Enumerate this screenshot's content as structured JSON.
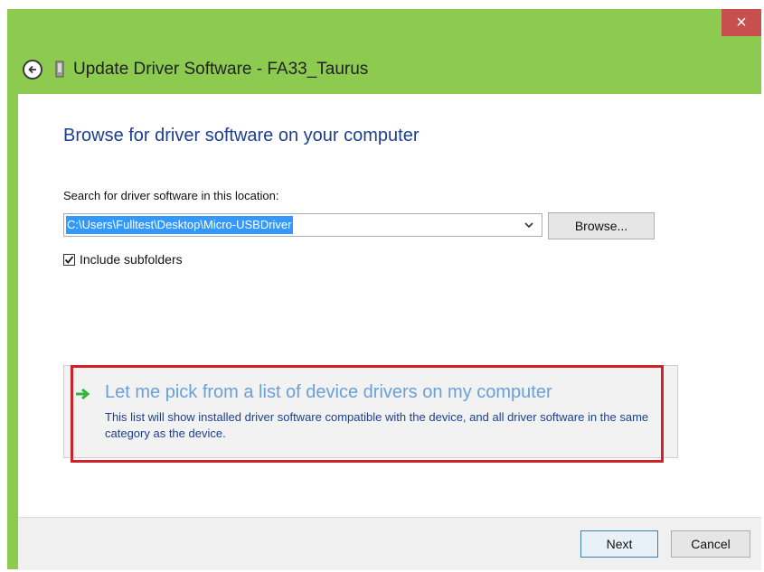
{
  "window": {
    "title": "Update Driver Software - FA33_Taurus",
    "close_label": "×"
  },
  "content": {
    "heading": "Browse for driver software on your computer",
    "search_label": "Search for driver software in this location:",
    "path_value": "C:\\Users\\Fulltest\\Desktop\\Micro-USBDriver",
    "browse_label": "Browse...",
    "include_subfolders_label": "Include subfolders",
    "include_subfolders_checked": true
  },
  "pick_option": {
    "title": "Let me pick from a list of device drivers on my computer",
    "description": "This list will show installed driver software compatible with the device, and all driver software in the same category as the device."
  },
  "footer": {
    "next_label": "Next",
    "cancel_label": "Cancel"
  },
  "colors": {
    "titlebar_green": "#8ccb50",
    "close_red": "#c7504e",
    "heading_blue": "#1c3f94",
    "link_blue": "#6aa0d8",
    "highlight_red": "#d0202a",
    "arrow_green": "#2fb53a"
  },
  "icons": {
    "back": "back-arrow-icon",
    "device": "usb-device-icon",
    "pick_arrow": "green-arrow-icon",
    "dropdown": "chevron-down-icon",
    "checkmark": "checkmark-icon"
  }
}
